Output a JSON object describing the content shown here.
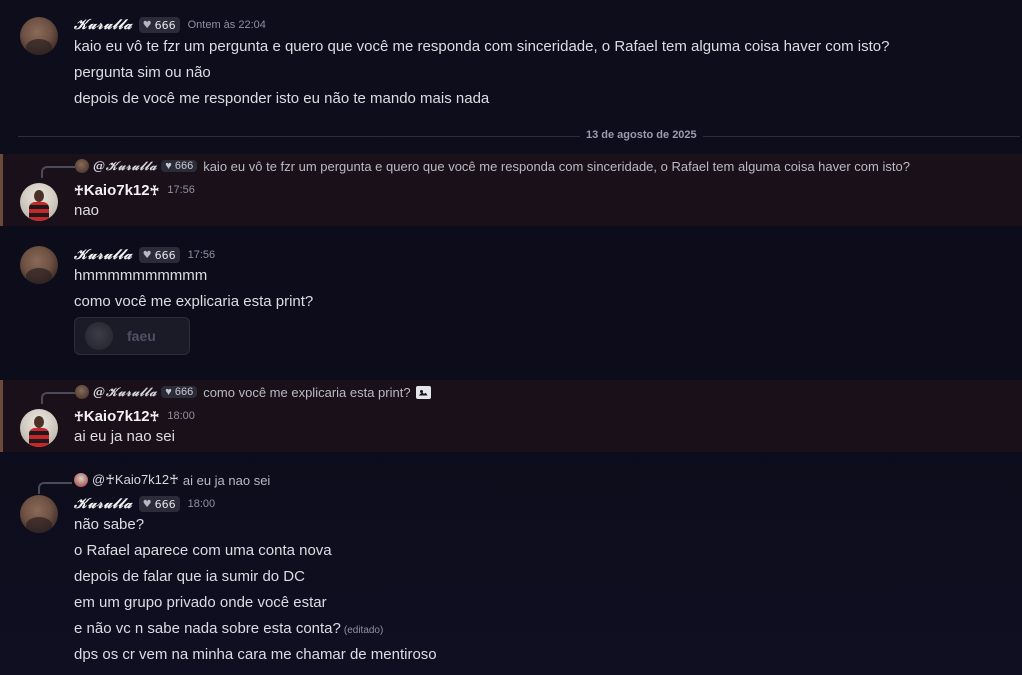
{
  "users": {
    "k": {
      "name": "𝒦𝓊𝓇𝓊𝓁𝓁𝒶",
      "badge": "666"
    },
    "c": {
      "name_prefix": "♰",
      "name": "Kaio7k12",
      "name_suffix": "♰"
    }
  },
  "messages": [
    {
      "time": "Ontem às 22:04",
      "lines": [
        "kaio eu vô te fzr um pergunta e quero que você me responda com sinceridade, o Rafael tem alguma coisa haver com isto?",
        "pergunta sim ou não",
        "depois de você me responder isto eu não te mando mais nada"
      ]
    },
    {
      "divider": "13 de agosto de 2025"
    },
    {
      "reply_to": "@𝒦𝓊𝓇𝓊𝓁𝓁𝒶",
      "reply_badge": "666",
      "reply_text": "kaio eu vô te fzr um pergunta e quero que você me responda com sinceridade, o Rafael tem alguma coisa haver com isto?",
      "time": "17:56",
      "lines": [
        "nao"
      ]
    },
    {
      "time": "17:56",
      "lines": [
        "hmmmmmmmmmm",
        "como você me explicaria esta print?"
      ],
      "attachment_label": "faeu"
    },
    {
      "reply_to": "@𝒦𝓊𝓇𝓊𝓁𝓁𝒶",
      "reply_badge": "666",
      "reply_text": "como você me explicaria esta print?",
      "time": "18:00",
      "lines": [
        "ai eu ja nao sei"
      ]
    },
    {
      "reply_to": "@♰Kaio7k12♰",
      "reply_text": "ai eu ja nao sei",
      "time": "18:00",
      "lines": [
        "não sabe?",
        "o Rafael aparece com uma conta nova",
        "depois de falar que ia sumir do DC",
        "em um grupo privado onde você estar",
        "e não vc n sabe nada sobre esta conta?",
        "dps os cr vem na minha cara me chamar de mentiroso"
      ],
      "edited": "(editado)"
    }
  ],
  "icons": {
    "heart": "heart-icon",
    "image": "image-icon"
  }
}
